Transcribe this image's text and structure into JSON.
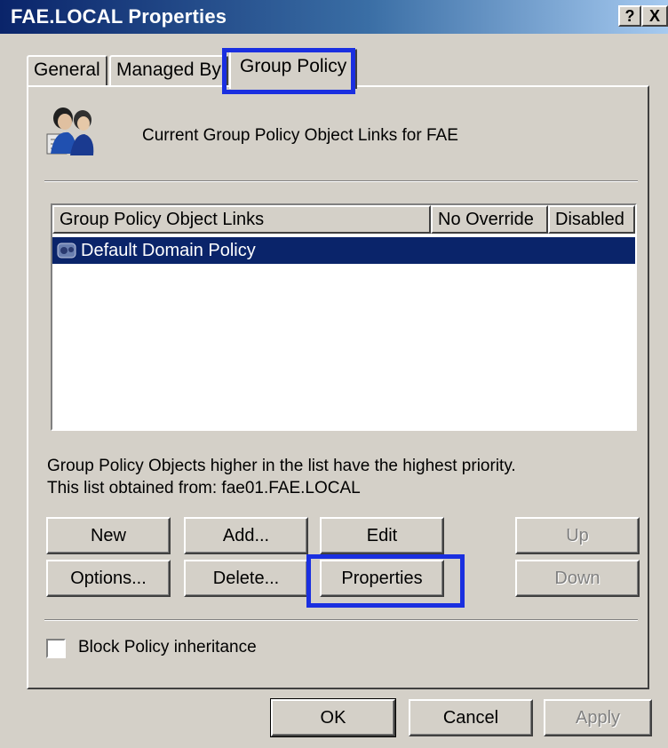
{
  "window": {
    "title": "FAE.LOCAL Properties",
    "help_label": "?",
    "close_label": "X"
  },
  "tabs": [
    {
      "label": "General"
    },
    {
      "label": "Managed By"
    },
    {
      "label": "Group Policy",
      "active": true
    }
  ],
  "header": {
    "text": "Current Group Policy Object Links for FAE",
    "icon": "users-group-icon"
  },
  "list": {
    "columns": [
      "Group Policy Object Links",
      "No Override",
      "Disabled"
    ],
    "rows": [
      {
        "name": "Default Domain Policy",
        "no_override": "",
        "disabled": "",
        "selected": true
      }
    ]
  },
  "info": {
    "line1": "Group Policy Objects higher in the list have the highest priority.",
    "line2": "This list obtained from: fae01.FAE.LOCAL"
  },
  "buttons": {
    "new": "New",
    "add": "Add...",
    "edit": "Edit",
    "up": "Up",
    "options": "Options...",
    "delete": "Delete...",
    "properties": "Properties",
    "down": "Down"
  },
  "checkbox": {
    "label": "Block Policy inheritance",
    "checked": false
  },
  "footer": {
    "ok": "OK",
    "cancel": "Cancel",
    "apply": "Apply"
  },
  "colors": {
    "highlight": "#1a2fe0",
    "selection": "#0a246a",
    "face": "#d4d0c8"
  }
}
